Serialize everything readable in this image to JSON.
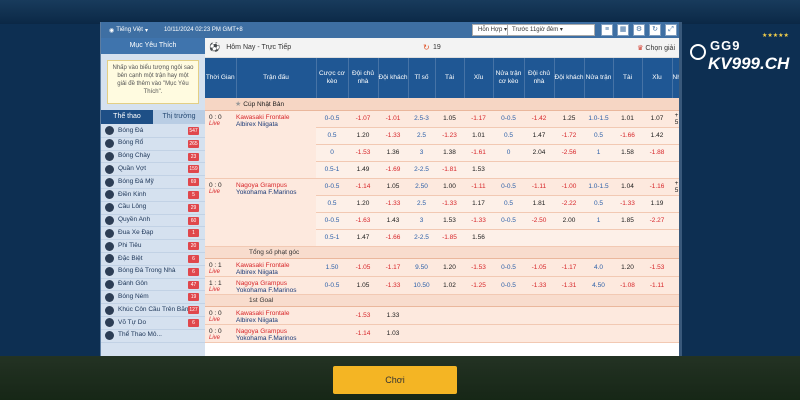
{
  "topbar": {
    "language": "Tiếng Việt",
    "datetime": "10/11/2024 02:23 PM GMT+8",
    "mode": "Hỗn Hợp",
    "filter": "Trước 11giờ đêm"
  },
  "sidebar": {
    "favorites_title": "Mục Yêu Thích",
    "favorites_hint": "Nhấp vào biểu tượng ngôi sao bên cạnh một trận hay một giải đề thêm vào \"Mục Yêu Thích\".",
    "tabs": [
      "Thể thao",
      "Thị trường"
    ],
    "sports": [
      {
        "label": "Bóng Đá",
        "count": "547"
      },
      {
        "label": "Bóng Rổ",
        "count": "265"
      },
      {
        "label": "Bóng Chày",
        "count": "23"
      },
      {
        "label": "Quần Vợt",
        "count": "159"
      },
      {
        "label": "Bóng Đá Mỹ",
        "count": "69"
      },
      {
        "label": "Điền Kinh",
        "count": "5"
      },
      {
        "label": "Cầu Lông",
        "count": "29"
      },
      {
        "label": "Quyền Anh",
        "count": "60"
      },
      {
        "label": "Đua Xe Đạp",
        "count": "1"
      },
      {
        "label": "Phi Tiêu",
        "count": "20"
      },
      {
        "label": "Đặc Biệt",
        "count": "6"
      },
      {
        "label": "Bóng Đá Trong Nhà",
        "count": "6"
      },
      {
        "label": "Đánh Gôn",
        "count": "47"
      },
      {
        "label": "Bóng Ném",
        "count": "19"
      },
      {
        "label": "Khúc Côn Cầu Trên Băng",
        "count": "127"
      },
      {
        "label": "Võ Tự Do",
        "count": "6"
      },
      {
        "label": "Thể Thao Mô...",
        "count": ""
      }
    ]
  },
  "main": {
    "header_title": "Hôm Nay - Trực Tiếp",
    "live_count": "19",
    "pick_league": "Chọn giải",
    "columns": [
      "Thời Gian",
      "Trận đấu",
      "Cược cơ kèo",
      "Đội chủ nhà",
      "Đội khách",
      "Tỉ số",
      "Tài",
      "Xỉu",
      "Nửa trận cơ kèo",
      "Đội chủ nhà",
      "Đội khách",
      "Nửa trận",
      "Tài",
      "Xỉu",
      "Nhiều"
    ],
    "league": "Cúp Nhật Bản",
    "matches": [
      {
        "time": "0 : 0",
        "status": "Live",
        "home": "Kawasaki Frontale",
        "away": "Albirex Niigata",
        "more": "+ 5",
        "rows": [
          [
            "0-0.5",
            "-1.07",
            "-1.01",
            "2.5-3",
            "1.05",
            "-1.17",
            "0-0.5",
            "-1.42",
            "1.25",
            "1.0-1.5",
            "1.01",
            "1.07"
          ],
          [
            "0.5",
            "1.20",
            "-1.33",
            "2.5",
            "-1.23",
            "1.01",
            "0.5",
            "1.47",
            "-1.72",
            "0.5",
            "-1.66",
            "1.42"
          ],
          [
            "0",
            "-1.53",
            "1.36",
            "3",
            "1.38",
            "-1.61",
            "0",
            "2.04",
            "-2.56",
            "1",
            "1.58",
            "-1.88"
          ],
          [
            "0.5-1",
            "1.49",
            "-1.69",
            "2-2.5",
            "-1.81",
            "1.53",
            "",
            "",
            "",
            "",
            "",
            ""
          ]
        ]
      },
      {
        "time": "0 : 0",
        "status": "Live",
        "home": "Nagoya Grampus",
        "away": "Yokohama F.Marinos",
        "more": "+ 5",
        "rows": [
          [
            "0-0.5",
            "-1.14",
            "1.05",
            "2.50",
            "1.00",
            "-1.11",
            "0-0.5",
            "-1.11",
            "-1.00",
            "1.0-1.5",
            "1.04",
            "-1.16"
          ],
          [
            "0.5",
            "1.20",
            "-1.33",
            "2.5",
            "-1.33",
            "1.17",
            "0.5",
            "1.81",
            "-2.22",
            "0.5",
            "-1.33",
            "1.19"
          ],
          [
            "0-0.5",
            "-1.63",
            "1.43",
            "3",
            "1.53",
            "-1.33",
            "0-0.5",
            "-2.50",
            "2.00",
            "1",
            "1.85",
            "-2.27"
          ],
          [
            "0.5-1",
            "1.47",
            "-1.66",
            "2-2.5",
            "-1.85",
            "1.56",
            "",
            "",
            "",
            "",
            "",
            ""
          ]
        ]
      }
    ],
    "section_corners": "Tổng số phạt góc",
    "corner_matches": [
      {
        "time": "0 : 1",
        "status": "Live",
        "home": "Kawasaki Frontale",
        "away": "Albirex Niigata",
        "row": [
          "1.50",
          "-1.05",
          "-1.17",
          "9.50",
          "1.20",
          "-1.53",
          "0-0.5",
          "-1.05",
          "-1.17",
          "4.0",
          "1.20",
          "-1.53"
        ]
      },
      {
        "time": "1 : 1",
        "status": "Live",
        "home": "Nagoya Grampus",
        "away": "Yokohama F.Marinos",
        "row": [
          "0-0.5",
          "1.05",
          "-1.33",
          "10.50",
          "1.02",
          "-1.25",
          "0-0.5",
          "-1.33",
          "-1.31",
          "4.50",
          "-1.08",
          "-1.11"
        ]
      }
    ],
    "section_first_goal": "1st Goal",
    "goal_matches": [
      {
        "time": "0 : 0",
        "status": "Live",
        "home": "Kawasaki Frontale",
        "away": "Albirex Niigata",
        "row": [
          "",
          "-1.53",
          "1.33",
          "",
          "",
          "",
          "",
          "",
          "",
          "",
          "",
          ""
        ]
      },
      {
        "time": "0 : 0",
        "status": "Live",
        "home": "Nagoya Grampus",
        "away": "Yokohama F.Marinos",
        "row": [
          "",
          "-1.14",
          "1.03",
          "",
          "",
          "",
          "",
          "",
          "",
          "",
          "",
          ""
        ]
      }
    ]
  },
  "logo": {
    "small": "GG9",
    "big": "KV999.CH"
  },
  "play_button": "Chơi",
  "colors": {
    "header_blue": "#1f5794",
    "odds_negative": "#d7262a",
    "button": "#f4b524"
  }
}
